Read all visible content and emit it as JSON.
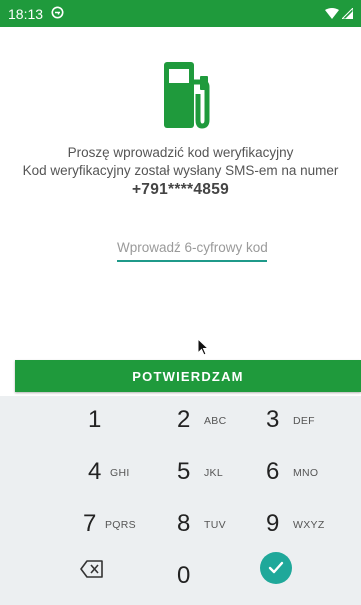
{
  "status_bar": {
    "time": "18:13",
    "left_icon": "vpn-key-icon",
    "right_icons": [
      "wifi-icon",
      "cellular-signal-icon"
    ]
  },
  "brand": {
    "icon": "fuel-pump-icon",
    "color": "#1f9a3c"
  },
  "message": {
    "line1": "Proszę wprowadzić kod weryfikacyjny",
    "line2": "Kod weryfikacyjny został wysłany SMS-em na numer",
    "phone": "+791****4859"
  },
  "code_input": {
    "placeholder": "Wprowadź 6-cyfrowy kod",
    "value": ""
  },
  "confirm_button": {
    "label": "POTWIERDZAM"
  },
  "keypad": {
    "keys": [
      {
        "digit": "1",
        "letters": ""
      },
      {
        "digit": "2",
        "letters": "ABC"
      },
      {
        "digit": "3",
        "letters": "DEF"
      },
      {
        "digit": "4",
        "letters": "GHI"
      },
      {
        "digit": "5",
        "letters": "JKL"
      },
      {
        "digit": "6",
        "letters": "MNO"
      },
      {
        "digit": "7",
        "letters": "PQRS"
      },
      {
        "digit": "8",
        "letters": "TUV"
      },
      {
        "digit": "9",
        "letters": "WXYZ"
      },
      {
        "digit": "0",
        "letters": ""
      }
    ],
    "delete_icon": "backspace-icon",
    "done_icon": "checkmark-icon",
    "background": "#eceff1",
    "accent": "#1fa89a"
  }
}
